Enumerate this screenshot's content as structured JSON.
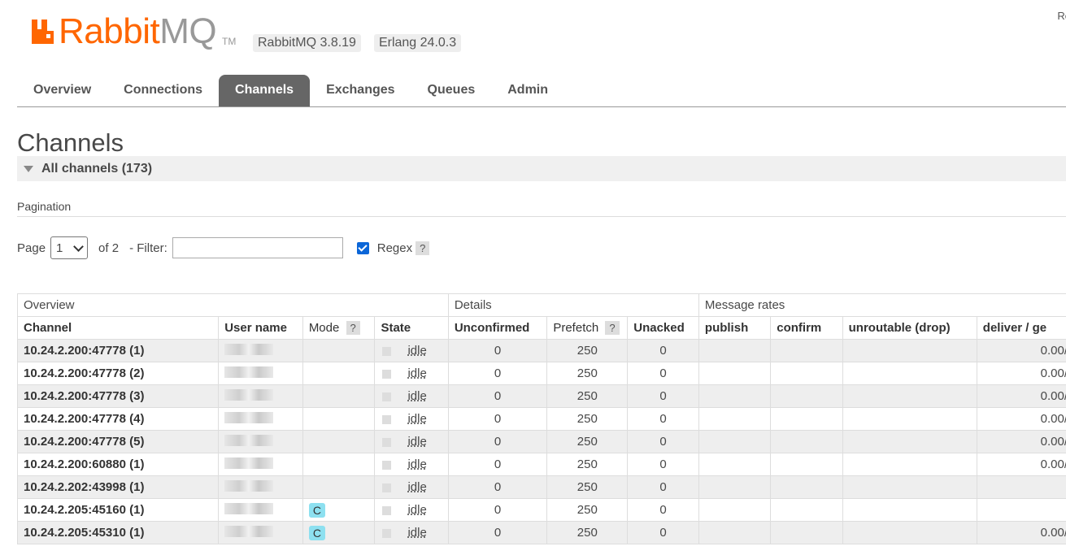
{
  "header": {
    "logo_text_main": "Rabbit",
    "logo_text_mq": "MQ",
    "logo_tm": "TM",
    "version_badges": [
      "RabbitMQ 3.8.19",
      "Erlang 24.0.3"
    ],
    "top_right_text": "Re"
  },
  "nav": {
    "tabs": [
      {
        "label": "Overview",
        "active": false
      },
      {
        "label": "Connections",
        "active": false
      },
      {
        "label": "Channels",
        "active": true
      },
      {
        "label": "Exchanges",
        "active": false
      },
      {
        "label": "Queues",
        "active": false
      },
      {
        "label": "Admin",
        "active": false
      }
    ]
  },
  "page": {
    "title": "Channels",
    "section_label": "All channels (173)",
    "pagination_label": "Pagination",
    "page_label": "Page",
    "page_value": "1",
    "of_text": "of 2",
    "filter_label": "- Filter:",
    "filter_value": "",
    "regex_label": "Regex",
    "regex_checked": true,
    "help_glyph": "?"
  },
  "table": {
    "groups": [
      "Overview",
      "Details",
      "Message rates"
    ],
    "columns": {
      "channel": "Channel",
      "user": "User name",
      "mode": "Mode",
      "state": "State",
      "unconfirmed": "Unconfirmed",
      "prefetch": "Prefetch",
      "unacked": "Unacked",
      "publish": "publish",
      "confirm": "confirm",
      "unroutable": "unroutable (drop)",
      "deliver": "deliver / ge"
    },
    "rows": [
      {
        "channel": "10.24.2.200:47778 (1)",
        "mode": "",
        "state": "idle",
        "unconfirmed": "0",
        "prefetch": "250",
        "unacked": "0",
        "deliver": "0.00/"
      },
      {
        "channel": "10.24.2.200:47778 (2)",
        "mode": "",
        "state": "idle",
        "unconfirmed": "0",
        "prefetch": "250",
        "unacked": "0",
        "deliver": "0.00/"
      },
      {
        "channel": "10.24.2.200:47778 (3)",
        "mode": "",
        "state": "idle",
        "unconfirmed": "0",
        "prefetch": "250",
        "unacked": "0",
        "deliver": "0.00/"
      },
      {
        "channel": "10.24.2.200:47778 (4)",
        "mode": "",
        "state": "idle",
        "unconfirmed": "0",
        "prefetch": "250",
        "unacked": "0",
        "deliver": "0.00/"
      },
      {
        "channel": "10.24.2.200:47778 (5)",
        "mode": "",
        "state": "idle",
        "unconfirmed": "0",
        "prefetch": "250",
        "unacked": "0",
        "deliver": "0.00/"
      },
      {
        "channel": "10.24.2.200:60880 (1)",
        "mode": "",
        "state": "idle",
        "unconfirmed": "0",
        "prefetch": "250",
        "unacked": "0",
        "deliver": "0.00/"
      },
      {
        "channel": "10.24.2.202:43998 (1)",
        "mode": "",
        "state": "idle",
        "unconfirmed": "0",
        "prefetch": "250",
        "unacked": "0",
        "deliver": ""
      },
      {
        "channel": "10.24.2.205:45160 (1)",
        "mode": "C",
        "state": "idle",
        "unconfirmed": "0",
        "prefetch": "250",
        "unacked": "0",
        "deliver": ""
      },
      {
        "channel": "10.24.2.205:45310 (1)",
        "mode": "C",
        "state": "idle",
        "unconfirmed": "0",
        "prefetch": "250",
        "unacked": "0",
        "deliver": "0.00/"
      }
    ]
  }
}
